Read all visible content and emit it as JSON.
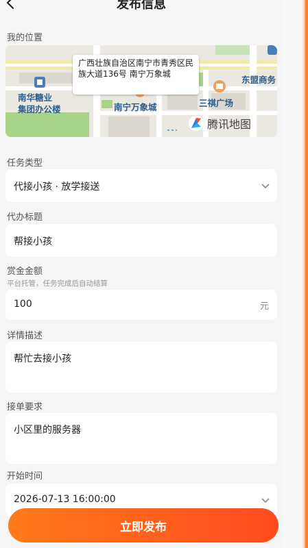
{
  "header": {
    "title": "发布信息"
  },
  "location": {
    "label": "我的位置",
    "address": "广西壮族自治区南宁市青秀区民族大道136号 南宁万象城",
    "map_labels": {
      "poi_left": "南华糖业\n集团办公楼",
      "poi_center": "南宁万象城",
      "poi_right": "三祺广场",
      "poi_top_right": "东盟商务"
    },
    "map_brand": "腾讯地图"
  },
  "task_type": {
    "label": "任务类型",
    "value": "代接小孩 · 放学接送"
  },
  "task_title": {
    "label": "代办标题",
    "value": "帮接小孩"
  },
  "reward": {
    "label": "赏金金额",
    "hint": "平台托管，任务完成后自动结算",
    "value": "100",
    "unit": "元"
  },
  "description": {
    "label": "详情描述",
    "value": "帮忙去接小孩"
  },
  "requirements": {
    "label": "接单要求",
    "value": "小区里的服务器"
  },
  "start_time": {
    "label": "开始时间",
    "value": "2026-07-13 16:00:00"
  },
  "submit": {
    "label": "立即发布"
  },
  "colors": {
    "accent": "#ff6a1f",
    "map_road": "#ffffff",
    "map_green": "#9ccf7c"
  }
}
